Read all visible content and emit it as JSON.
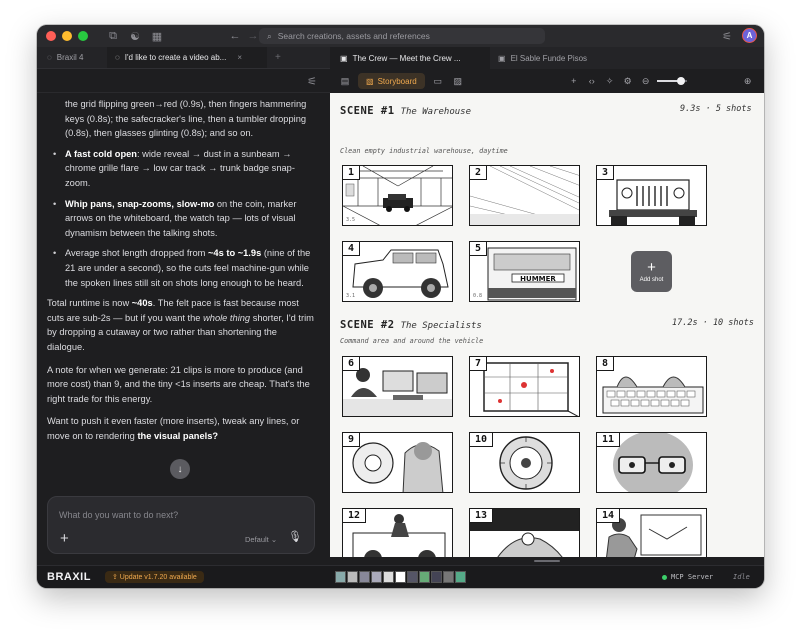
{
  "titlebar": {
    "search_placeholder": "Search creations, assets and references",
    "avatar_initial": "A",
    "traffic_lights": [
      "#ff5f57",
      "#febc2e",
      "#28c840"
    ]
  },
  "left_tabs": [
    {
      "label": "Braxil 4"
    },
    {
      "label": "I'd like to create a video ab..."
    }
  ],
  "right_tabs": [
    {
      "label": "The Crew — Meet the Crew ..."
    },
    {
      "label": "El Sable Funde Pisos"
    }
  ],
  "chat": {
    "b0_text": "the grid flipping green→red (0.9s), then fingers hammering keys (0.8s); the safecracker's line, then a tumbler dropping (0.8s), then glasses glinting (0.8s); and so on.",
    "b1_bold": "A fast cold open",
    "b1_text": ": wide reveal → dust in a sunbeam → chrome grille flare → low car track → trunk badge snap-zoom.",
    "b2_bold": "Whip pans, snap-zooms, slow-mo",
    "b2_text": " on the coin, marker arrows on the whiteboard, the watch tap — lots of visual dynamism between the talking shots.",
    "b3_pre": "Average shot length dropped from ",
    "b3_bold": "~4s to ~1.9s",
    "b3_text": " (nine of the 21 are under a second), so the cuts feel machine-gun while the spoken lines still sit on shots long enough to be heard.",
    "p1_pre": "Total runtime is now ",
    "p1_bold": "~40s",
    "p1_mid": ". The felt pace is fast because most cuts are sub-2s — but if you want the ",
    "p1_em": "whole thing",
    "p1_post": " shorter, I'd trim by dropping a cutaway or two rather than shortening the dialogue.",
    "p2": "A note for when we generate: 21 clips is more to produce (and more cost) than 9, and the tiny <1s inserts are cheap. That's the right trade for this energy.",
    "p3_pre": "Want to push it even faster (more inserts), tweak any lines, or move on to rendering ",
    "p3_bold": "the visual panels?",
    "composer_placeholder": "What do you want to do next?",
    "mode": "Default"
  },
  "toolbar": {
    "storyboard_label": "Storyboard",
    "zoom_fraction": 0.8
  },
  "scenes": [
    {
      "title": "SCENE #1",
      "subtitle": "The Warehouse",
      "meta": "9.3s · 5 shots",
      "desc": "Clean empty industrial warehouse, daytime",
      "shots": [
        {
          "num": "1",
          "dur": "3.5"
        },
        {
          "num": "2",
          "dur": ""
        },
        {
          "num": "3",
          "dur": ""
        },
        {
          "num": "4",
          "dur": "3.1"
        },
        {
          "num": "5",
          "dur": "0.8"
        }
      ],
      "add_label": "Add shot"
    },
    {
      "title": "SCENE #2",
      "subtitle": "The Specialists",
      "meta": "17.2s · 10 shots",
      "desc": "Command area and around the vehicle",
      "shots": [
        {
          "num": "6"
        },
        {
          "num": "7"
        },
        {
          "num": "8"
        },
        {
          "num": "9"
        },
        {
          "num": "10"
        },
        {
          "num": "11"
        },
        {
          "num": "12"
        },
        {
          "num": "13"
        },
        {
          "num": "14"
        }
      ]
    }
  ],
  "panel_text": {
    "truck_badge": "HUMMER"
  },
  "bottom": {
    "logo": "BRAXIL",
    "update": "Update v1.7.20 available",
    "mcp": "MCP Server",
    "status": "Idle",
    "mcp_color": "#3ccf6a"
  }
}
